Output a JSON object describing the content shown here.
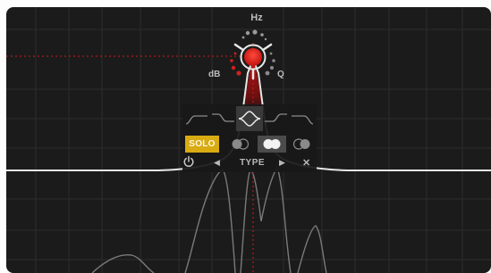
{
  "knob": {
    "hz_label": "Hz",
    "db_label": "dB",
    "q_label": "Q"
  },
  "type_panel": {
    "solo_label": "SOLO",
    "type_label": "TYPE",
    "shape_icons": [
      "low-cut-icon",
      "low-shelf-icon",
      "bell-icon",
      "high-shelf-icon",
      "high-cut-icon"
    ],
    "active_shape": "bell",
    "stereo_icons": [
      "left-channel-icon",
      "stereo-icon",
      "right-channel-icon"
    ],
    "active_stereo": "stereo"
  },
  "colors": {
    "background": "#1b1b1b",
    "grid": "#2d2d2d",
    "accent_red": "#e31b1b",
    "solo_yellow": "#d8ab12",
    "curve": "#e8e8e8"
  }
}
